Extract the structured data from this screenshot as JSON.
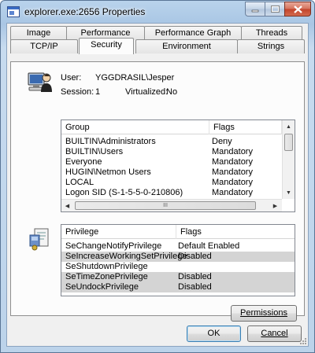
{
  "window": {
    "title": "explorer.exe:2656 Properties",
    "accent": "#a9c6e4"
  },
  "tabs": {
    "row1": [
      "Image",
      "Performance",
      "Performance Graph",
      "Threads"
    ],
    "row2": [
      "TCP/IP",
      "Security",
      "Environment",
      "Strings"
    ],
    "active": "Security"
  },
  "security": {
    "user_label": "User:",
    "user_value": "YGGDRASIL\\Jesper",
    "session_label": "Session:",
    "session_value": "1",
    "virtualized_label": "Virtualized:",
    "virtualized_value": "No",
    "groups": {
      "columns": [
        "Group",
        "Flags"
      ],
      "rows": [
        {
          "group": "BUILTIN\\Administrators",
          "flags": "Deny"
        },
        {
          "group": "BUILTIN\\Users",
          "flags": "Mandatory"
        },
        {
          "group": "Everyone",
          "flags": "Mandatory"
        },
        {
          "group": "HUGIN\\Netmon Users",
          "flags": "Mandatory"
        },
        {
          "group": "LOCAL",
          "flags": "Mandatory"
        },
        {
          "group": "Logon SID (S-1-5-5-0-210806)",
          "flags": "Mandatory"
        }
      ],
      "hscroll_grip": "III"
    },
    "privileges": {
      "columns": [
        "Privilege",
        "Flags"
      ],
      "rows": [
        {
          "privilege": "SeChangeNotifyPrivilege",
          "flags": "Default Enabled",
          "shaded": false
        },
        {
          "privilege": "SeIncreaseWorkingSetPrivilege",
          "flags": "Disabled",
          "shaded": true
        },
        {
          "privilege": "SeShutdownPrivilege",
          "flags": "",
          "shaded": false
        },
        {
          "privilege": "SeTimeZonePrivilege",
          "flags": "Disabled",
          "shaded": true
        },
        {
          "privilege": "SeUndockPrivilege",
          "flags": "Disabled",
          "shaded": true
        }
      ]
    },
    "permissions_button": "Permissions"
  },
  "buttons": {
    "ok": "OK",
    "cancel": "Cancel"
  }
}
